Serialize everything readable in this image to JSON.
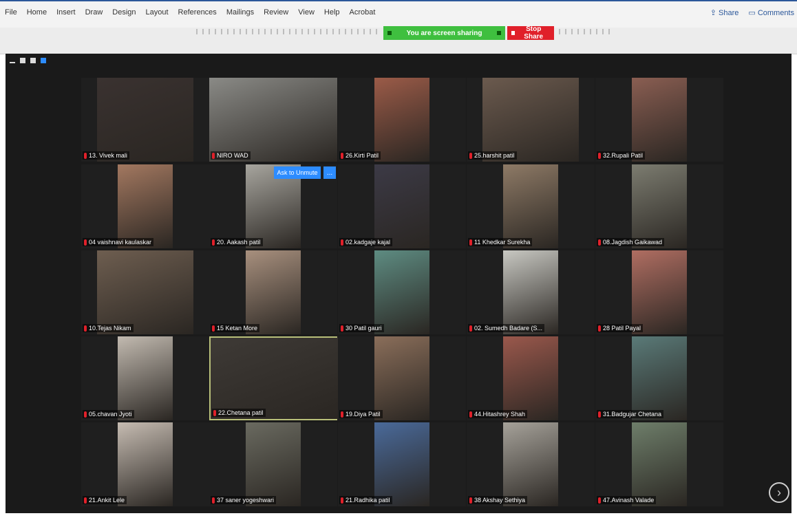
{
  "menu": [
    "File",
    "Home",
    "Insert",
    "Draw",
    "Design",
    "Layout",
    "References",
    "Mailings",
    "Review",
    "View",
    "Help",
    "Acrobat"
  ],
  "share_label": "Share",
  "comments_label": "Comments",
  "sharing_banner": "You are screen sharing",
  "stop_share_label": "Stop Share",
  "ask_to_unmute_label": "Ask to Unmute",
  "more_label": "...",
  "next_page_label": "›",
  "participants": [
    {
      "name": "13. Vivek mali",
      "tone": "#3a3230"
    },
    {
      "name": "NIRO WAD",
      "tone": "#8a8a86"
    },
    {
      "name": "26.Kirti Patil",
      "tone": "#9b5b48"
    },
    {
      "name": "25.harshit patil",
      "tone": "#6b5a4e"
    },
    {
      "name": "32.Rupali Patil",
      "tone": "#8a5e52"
    },
    {
      "name": "04 vaishnavi kaulaskar",
      "tone": "#a37860"
    },
    {
      "name": "20. Aakash patil",
      "tone": "#a7a59e"
    },
    {
      "name": "02.kadgaje kajal",
      "tone": "#3c3a46"
    },
    {
      "name": "11 Khedkar Surekha",
      "tone": "#8e7a66"
    },
    {
      "name": "08.Jagdish Gaikawad",
      "tone": "#7c7c70"
    },
    {
      "name": "10.Tejas Nikam",
      "tone": "#6e5e50"
    },
    {
      "name": "15 Ketan More",
      "tone": "#a8907e"
    },
    {
      "name": "30 Patil gauri",
      "tone": "#5e8c82"
    },
    {
      "name": "02. Sumedh Badare (S...",
      "tone": "#c8c8c2"
    },
    {
      "name": "28 Patil Payal",
      "tone": "#b06e62"
    },
    {
      "name": "05.chavan Jyoti",
      "tone": "#c2bab0"
    },
    {
      "name": "22.Chetana patil",
      "tone": "#3e3a36"
    },
    {
      "name": "19.Diya Patil",
      "tone": "#8a6e5a"
    },
    {
      "name": "44.Hitashrey Shah",
      "tone": "#9a584c"
    },
    {
      "name": "31.Badgujar Chetana",
      "tone": "#5a7a78"
    },
    {
      "name": "21.Ankit Lele",
      "tone": "#c6bcb2"
    },
    {
      "name": "37 saner yogeshwari",
      "tone": "#6a6a60"
    },
    {
      "name": "21.Radhika patil",
      "tone": "#4a6a9a"
    },
    {
      "name": "38 Akshay Sethiya",
      "tone": "#a6a29a"
    },
    {
      "name": "47.Avinash Valade",
      "tone": "#6e7e6a"
    }
  ],
  "selected_participant_index": 16
}
